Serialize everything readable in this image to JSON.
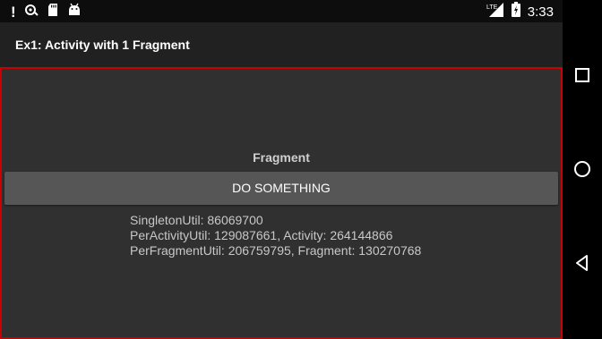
{
  "status_bar": {
    "time": "3:33",
    "network": "LTE"
  },
  "app": {
    "title": "Ex1: Activity with 1 Fragment"
  },
  "fragment": {
    "label": "Fragment",
    "button_label": "DO SOMETHING",
    "lines": [
      "SingletonUtil: 86069700",
      "PerActivityUtil: 129087661, Activity: 264144866",
      "PerFragmentUtil: 206759795, Fragment: 130270768"
    ]
  },
  "colors": {
    "fragment_border": "#cc0000",
    "action_bar": "#212121",
    "background": "#303030",
    "button": "#565656"
  },
  "nav": {
    "icons": [
      "recents-icon",
      "home-icon",
      "back-icon"
    ]
  }
}
